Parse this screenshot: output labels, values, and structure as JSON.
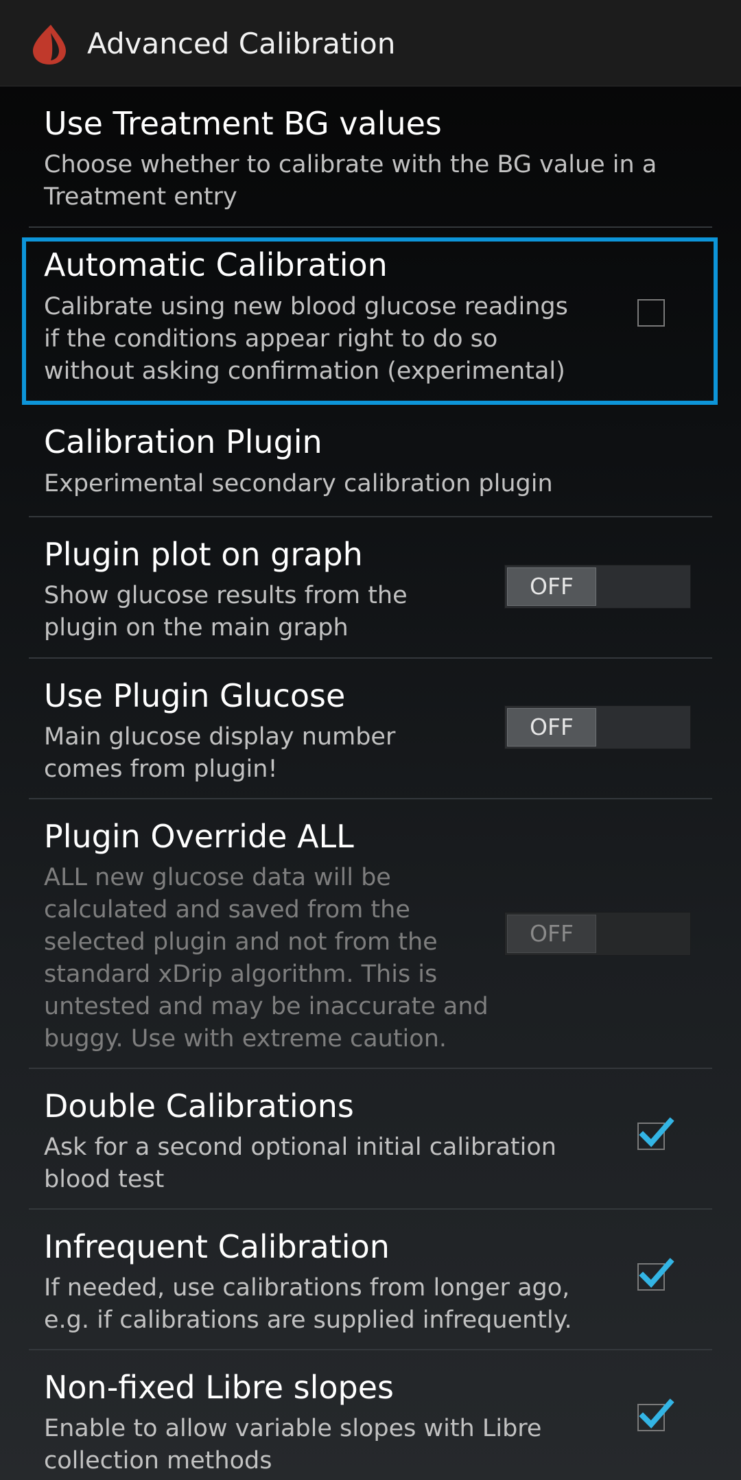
{
  "header": {
    "title": "Advanced Calibration",
    "icon": "blood-drop-icon",
    "icon_color": "#c0392b"
  },
  "accent_color": "#0d95d9",
  "preferences": [
    {
      "title": "Use Treatment BG values",
      "summary": "Choose whether to calibrate with the BG value in a\nTreatment entry",
      "widget": "none"
    },
    {
      "title": "Automatic Calibration",
      "summary": "Calibrate using new blood glucose readings\nif the conditions appear right to do so\nwithout asking confirmation (experimental)",
      "widget": "checkbox",
      "checked": false,
      "highlighted": true
    },
    {
      "title": "Calibration Plugin",
      "summary": "Experimental secondary calibration plugin",
      "widget": "none"
    },
    {
      "title": "Plugin plot on graph",
      "summary": "Show glucose results from the\nplugin on the main graph",
      "widget": "switch",
      "switch_label": "OFF",
      "checked": false
    },
    {
      "title": "Use Plugin Glucose",
      "summary": "Main glucose display number\ncomes from plugin!",
      "widget": "switch",
      "switch_label": "OFF",
      "checked": false
    },
    {
      "title": "Plugin Override ALL",
      "summary": "ALL new glucose data will be\ncalculated and saved from the\nselected plugin and not from the\nstandard xDrip algorithm. This is\nuntested and may be inaccurate and\nbuggy. Use with extreme caution.",
      "widget": "switch",
      "switch_label": "OFF",
      "checked": false,
      "enabled": false
    },
    {
      "title": "Double Calibrations",
      "summary": "Ask for a second optional initial calibration\nblood test",
      "widget": "checkbox",
      "checked": true
    },
    {
      "title": "Infrequent Calibration",
      "summary": "If needed, use calibrations from longer ago,\ne.g. if calibrations are supplied infrequently.",
      "widget": "checkbox",
      "checked": true
    },
    {
      "title": "Non-fixed Libre slopes",
      "summary": "Enable to allow variable slopes with Libre\ncollection methods",
      "widget": "checkbox",
      "checked": true
    }
  ]
}
